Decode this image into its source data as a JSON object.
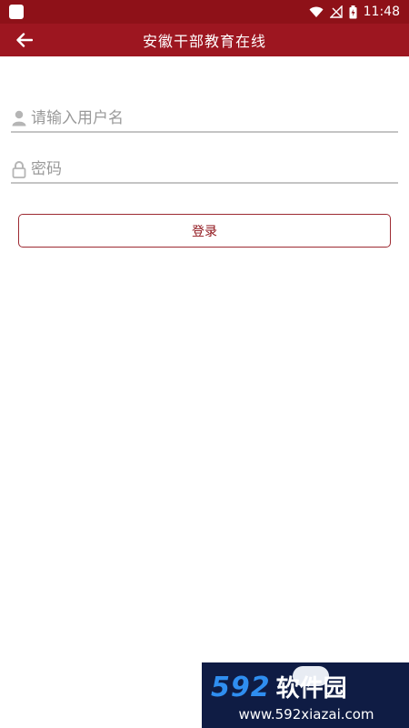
{
  "status_bar": {
    "time": "11:48"
  },
  "app_bar": {
    "title": "安徽干部教育在线"
  },
  "login": {
    "username_placeholder": "请输入用户名",
    "password_placeholder": "密码",
    "submit_label": "登录"
  },
  "watermark": {
    "number": "592",
    "name": "软件园",
    "url": "www.592xiazai.com"
  },
  "colors": {
    "brand": "#9d1620",
    "status_bar": "#8e1118",
    "underline": "#c4c4c4"
  }
}
